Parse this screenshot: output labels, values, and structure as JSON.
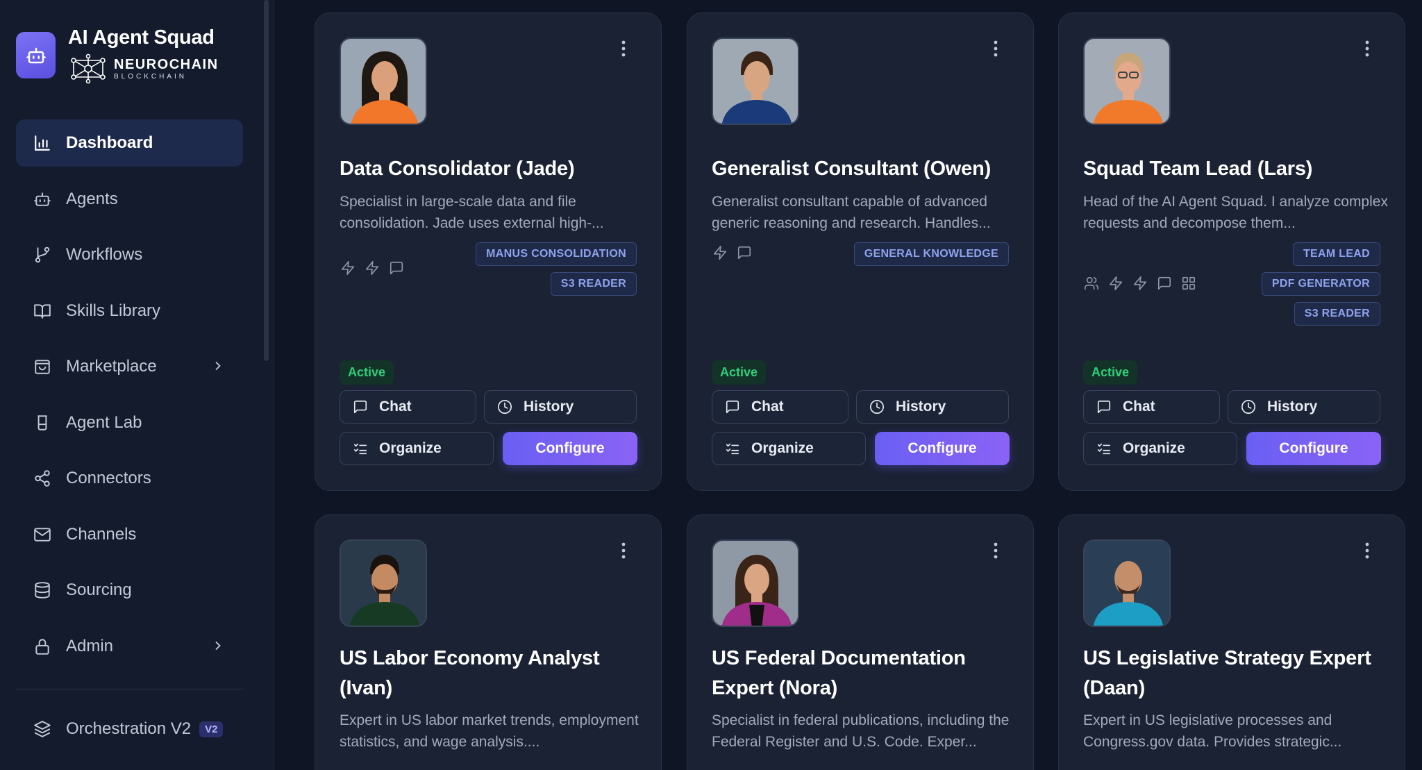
{
  "brand": {
    "title": "AI Agent Squad",
    "logo_main": "NEUROCHAIN",
    "logo_sub": "BLOCKCHAIN",
    "icon": "robot-icon"
  },
  "nav": {
    "items": [
      {
        "label": "Dashboard",
        "icon": "bar-chart-icon",
        "active": true
      },
      {
        "label": "Agents",
        "icon": "robot-icon"
      },
      {
        "label": "Workflows",
        "icon": "git-branch-icon"
      },
      {
        "label": "Skills Library",
        "icon": "book-icon"
      },
      {
        "label": "Marketplace",
        "icon": "shopping-bag-icon",
        "has_submenu": true
      },
      {
        "label": "Agent Lab",
        "icon": "flask-icon"
      },
      {
        "label": "Connectors",
        "icon": "share-icon"
      },
      {
        "label": "Channels",
        "icon": "mail-icon"
      },
      {
        "label": "Sourcing",
        "icon": "database-icon"
      },
      {
        "label": "Admin",
        "icon": "lock-icon",
        "has_submenu": true
      }
    ],
    "orchestration": {
      "label": "Orchestration V2",
      "badge": "V2",
      "icon": "layers-icon"
    }
  },
  "buttons": {
    "chat": "Chat",
    "history": "History",
    "organize": "Organize",
    "configure": "Configure"
  },
  "colors": {
    "accent": "#6a5ff3",
    "active_status": "#2fcf7a",
    "tag_text": "#8fa3ee",
    "card_bg": "#1a2233",
    "page_bg": "#0f1524"
  },
  "agents": [
    {
      "name": "Data Consolidator (Jade)",
      "description": "Specialist in large-scale data and file consolidation. Jade uses external high-...",
      "tags": [
        "MANUS CONSOLIDATION",
        "S3 READER"
      ],
      "capabilities": [
        "zap-icon",
        "zap-icon",
        "message-square-icon"
      ],
      "status": "Active",
      "avatar": {
        "shirt": "#f2772a",
        "hair": "#1e1712",
        "skin": "#d9a07b",
        "bg": "#9aa6b3"
      }
    },
    {
      "name": "Generalist Consultant (Owen)",
      "description": "Generalist consultant capable of advanced generic reasoning and research. Handles...",
      "tags": [
        "GENERAL KNOWLEDGE"
      ],
      "capabilities": [
        "zap-icon",
        "message-square-icon"
      ],
      "status": "Active",
      "avatar": {
        "shirt": "#1a3a7a",
        "hair": "#3a2418",
        "skin": "#d7a582",
        "bg": "#9fa9b4"
      }
    },
    {
      "name": "Squad Team Lead (Lars)",
      "description": "Head of the AI Agent Squad. I analyze complex requests and decompose them...",
      "tags": [
        "TEAM LEAD",
        "PDF GENERATOR",
        "S3 READER"
      ],
      "capabilities": [
        "users-icon",
        "zap-icon",
        "zap-icon",
        "message-square-icon",
        "grid-icon"
      ],
      "status": "Active",
      "avatar": {
        "shirt": "#f07a2a",
        "hair": "#c9a57a",
        "skin": "#e2a98a",
        "bg": "#a2abb6"
      }
    },
    {
      "name": "US Labor Economy Analyst (Ivan)",
      "description": "Expert in US labor market trends, employment statistics, and wage analysis....",
      "avatar": {
        "shirt": "#173a24",
        "hair": "#1a120e",
        "skin": "#c48a62",
        "bg": "#2a3a4a"
      }
    },
    {
      "name": "US Federal Documentation Expert (Nora)",
      "description": "Specialist in federal publications, including the Federal Register and U.S. Code. Exper...",
      "avatar": {
        "shirt": "#a12d8a",
        "hair": "#3a2418",
        "skin": "#d9a583",
        "bg": "#8f98a5"
      }
    },
    {
      "name": "US Legislative Strategy Expert (Daan)",
      "description": "Expert in US legislative processes and Congress.gov data. Provides strategic...",
      "avatar": {
        "shirt": "#1d9ec4",
        "hair": "#3a2a20",
        "skin": "#c58e6a",
        "bg": "#2a3f55"
      }
    }
  ]
}
